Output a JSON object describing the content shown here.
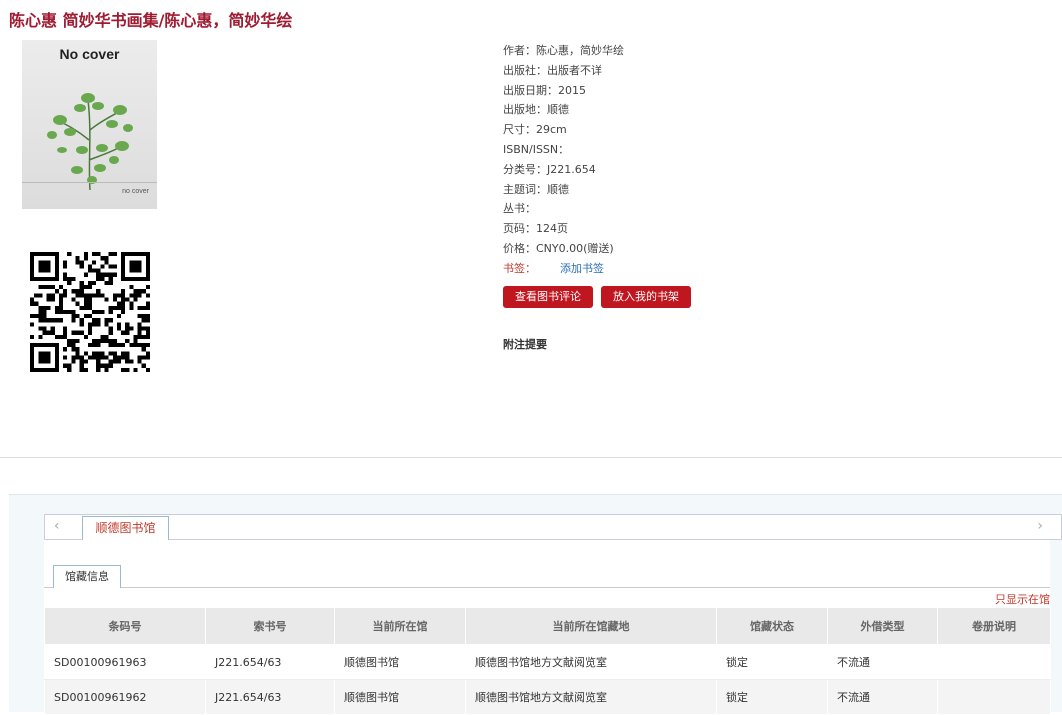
{
  "title": "陈心惠 简妙华书画集/陈心惠，简妙华绘",
  "cover": {
    "top_text": "No cover",
    "bottom_text": "no cover"
  },
  "meta": [
    "作者：陈心惠，简妙华绘",
    "出版社：出版者不详",
    "出版日期：2015",
    "出版地：顺德",
    "尺寸：29cm",
    "ISBN/ISSN：",
    "分类号：J221.654",
    "主题词：顺德",
    "丛书：",
    "页码：124页",
    "价格：CNY0.00(赠送)"
  ],
  "bookmark": {
    "label": "书签：",
    "link": "添加书签"
  },
  "buttons": {
    "review": "查看图书评论",
    "shelf": "放入我的书架"
  },
  "notes_heading": "附注提要",
  "library_tab": "顺德图书馆",
  "holdings_tab": "馆藏信息",
  "only_show_link": "只显示在馆",
  "table": {
    "headers": [
      "条码号",
      "索书号",
      "当前所在馆",
      "当前所在馆藏地",
      "馆藏状态",
      "外借类型",
      "卷册说明"
    ],
    "rows": [
      [
        "SD00100961963",
        "J221.654/63",
        "顺德图书馆",
        "顺德图书馆地方文献阅览室",
        "锁定",
        "不流通",
        ""
      ],
      [
        "SD00100961962",
        "J221.654/63",
        "顺德图书馆",
        "顺德图书馆地方文献阅览室",
        "锁定",
        "不流通",
        ""
      ]
    ]
  },
  "icons": {
    "prev": "chevron-left-icon",
    "next": "chevron-right-icon"
  }
}
